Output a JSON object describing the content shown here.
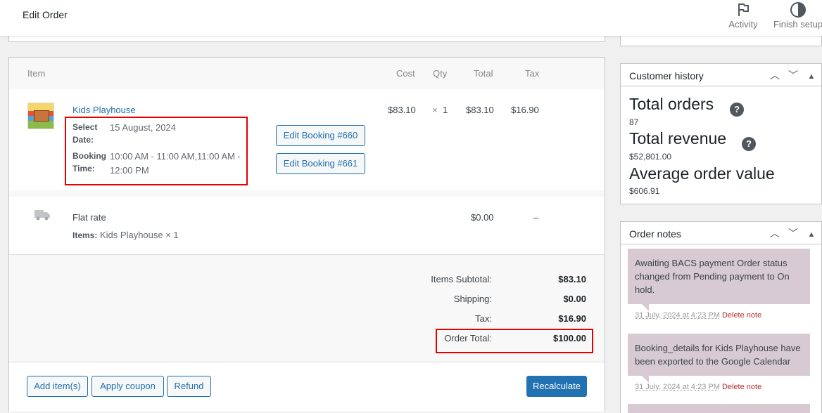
{
  "header": {
    "title": "Edit Order",
    "activity_label": "Activity",
    "finish_label": "Finish setup"
  },
  "items": {
    "columns": {
      "item": "Item",
      "cost": "Cost",
      "qty": "Qty",
      "total": "Total",
      "tax": "Tax"
    },
    "product": {
      "name": "Kids Playhouse",
      "meta": [
        {
          "key": "Select Date:",
          "value": "15 August, 2024"
        },
        {
          "key": "Booking Time:",
          "value": "10:00 AM - 11:00 AM,11:00 AM - 12:00 PM"
        }
      ],
      "cost": "$83.10",
      "qty_sep": "×",
      "qty": "1",
      "total": "$83.10",
      "tax": "$16.90",
      "booking_buttons": [
        "Edit Booking #660",
        "Edit Booking #661"
      ]
    },
    "shipping": {
      "name": "Flat rate",
      "items_key": "Items:",
      "items_value": "Kids Playhouse × 1",
      "total": "$0.00",
      "tax": "–"
    },
    "totals": [
      {
        "label": "Items Subtotal:",
        "value": "$83.10"
      },
      {
        "label": "Shipping:",
        "value": "$0.00"
      },
      {
        "label": "Tax:",
        "value": "$16.90"
      },
      {
        "label": "Order Total:",
        "value": "$100.00"
      }
    ],
    "actions": {
      "add_item": "Add item(s)",
      "apply_coupon": "Apply coupon",
      "refund": "Refund",
      "recalculate": "Recalculate"
    }
  },
  "customer_history": {
    "title": "Customer history",
    "total_orders_label": "Total orders",
    "total_orders_value": "87",
    "total_revenue_label": "Total revenue",
    "total_revenue_value": "$52,801.00",
    "aov_label": "Average order value",
    "aov_value": "$606.91",
    "help_glyph": "?"
  },
  "order_notes": {
    "title": "Order notes",
    "notes": [
      {
        "text": "Awaiting BACS payment Order status changed from Pending payment to On hold.",
        "timestamp": "31 July, 2024 at 4:23 PM",
        "delete": "Delete note"
      },
      {
        "text": "Booking_details for Kids Playhouse have been exported to the Google Calendar",
        "timestamp": "31 July, 2024 at 4:23 PM",
        "delete": "Delete note"
      }
    ]
  },
  "icons": {
    "activity": "flag-icon",
    "finish": "half-circle-icon",
    "shipping": "truck-icon",
    "collapse_up": "chevron-up-icon",
    "collapse_down": "chevron-down-icon",
    "toggle": "triangle-up-icon"
  },
  "colors": {
    "accent": "#2271b1",
    "highlight": "#e60000",
    "note_bg": "#d7cad2",
    "delete": "#b32d2e"
  }
}
